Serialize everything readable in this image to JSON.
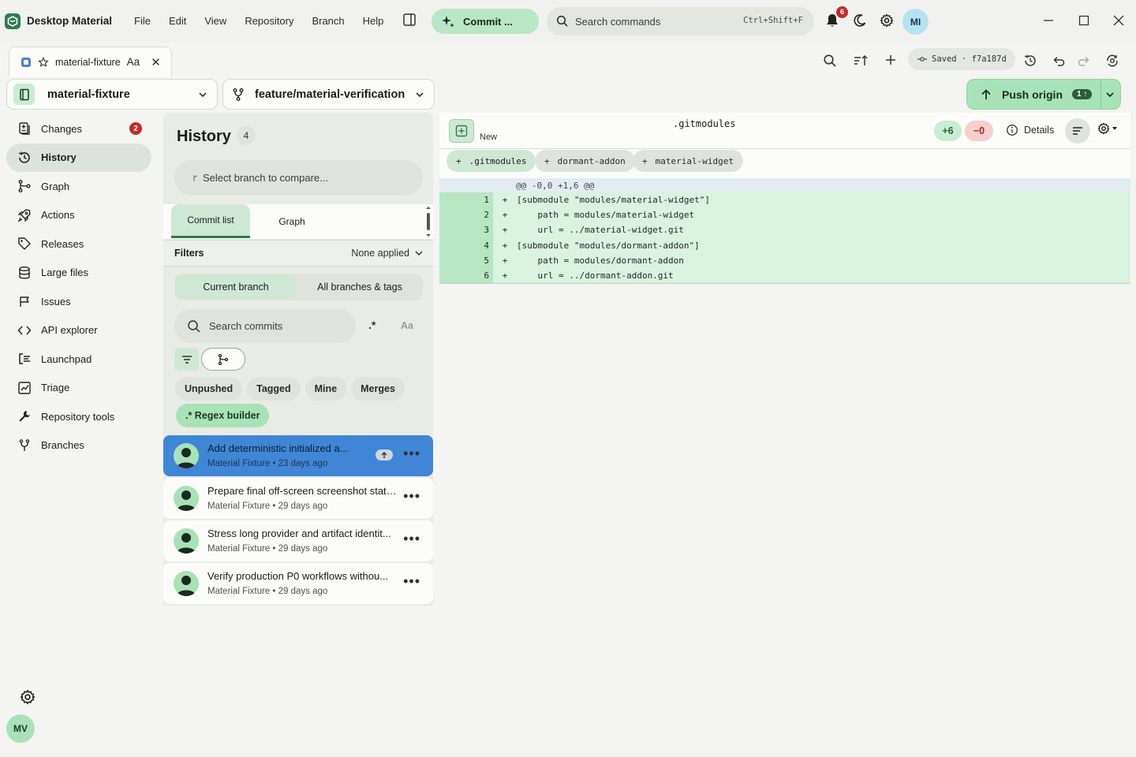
{
  "app": {
    "name": "Desktop Material"
  },
  "menu": [
    "File",
    "Edit",
    "View",
    "Repository",
    "Branch",
    "Help"
  ],
  "commit_button": {
    "label": "Commit ..."
  },
  "command_search": {
    "placeholder": "Search commands",
    "shortcut": "Ctrl+Shift+F"
  },
  "notifications": {
    "count": "6"
  },
  "user": {
    "initials": "MI"
  },
  "tab": {
    "title": "material-fixture",
    "font_toggle": "Aa"
  },
  "save_status": {
    "text": "Saved · f7a187d"
  },
  "repo": {
    "name": "material-fixture"
  },
  "branch": {
    "name": "feature/material-verification"
  },
  "push": {
    "label": "Push origin",
    "count": "1"
  },
  "sidebar": {
    "items": [
      {
        "label": "Changes",
        "icon": "changes-icon",
        "badge": "2"
      },
      {
        "label": "History",
        "icon": "history-icon"
      },
      {
        "label": "Graph",
        "icon": "graph-icon"
      },
      {
        "label": "Actions",
        "icon": "rocket-icon"
      },
      {
        "label": "Releases",
        "icon": "tag-icon"
      },
      {
        "label": "Large files",
        "icon": "database-icon"
      },
      {
        "label": "Issues",
        "icon": "issue-icon"
      },
      {
        "label": "API explorer",
        "icon": "code-icon"
      },
      {
        "label": "Launchpad",
        "icon": "launchpad-icon"
      },
      {
        "label": "Triage",
        "icon": "triage-icon"
      },
      {
        "label": "Repository tools",
        "icon": "wrench-icon"
      },
      {
        "label": "Branches",
        "icon": "branch-icon"
      }
    ],
    "active": "History",
    "user_initials": "MV"
  },
  "history": {
    "title": "History",
    "count": "4",
    "compare_placeholder": "Select branch to compare...",
    "tabs": [
      "Commit list",
      "Graph"
    ],
    "filters_label": "Filters",
    "filters_value": "None applied",
    "scope": [
      "Current branch",
      "All branches & tags"
    ],
    "search_placeholder": "Search commits",
    "regex_toggle": ".*",
    "case_toggle": "Aa",
    "quick_filters": [
      "Unpushed",
      "Tagged",
      "Mine",
      "Merges"
    ],
    "regex_builder": ".* Regex builder",
    "commits": [
      {
        "title": "Add deterministic initialized a...",
        "meta": "Material Fixture • 23 days ago",
        "selected": true,
        "unpushed": true
      },
      {
        "title": "Prepare final off-screen screenshot states",
        "meta": "Material Fixture • 29 days ago"
      },
      {
        "title": "Stress long provider and artifact identit...",
        "meta": "Material Fixture • 29 days ago"
      },
      {
        "title": "Verify production P0 workflows withou...",
        "meta": "Material Fixture • 29 days ago"
      }
    ]
  },
  "diff": {
    "status": "New",
    "filename": ".gitmodules",
    "additions": "+6",
    "deletions": "−0",
    "details_label": "Details",
    "files": [
      ".gitmodules",
      "dormant-addon",
      "material-widget"
    ],
    "hunk": "@@ -0,0 +1,6 @@",
    "lines": [
      {
        "n": "1",
        "sign": "+",
        "code": "[submodule \"modules/material-widget\"]"
      },
      {
        "n": "2",
        "sign": "+",
        "code": "    path = modules/material-widget"
      },
      {
        "n": "3",
        "sign": "+",
        "code": "    url = ../material-widget.git"
      },
      {
        "n": "4",
        "sign": "+",
        "code": "[submodule \"modules/dormant-addon\"]"
      },
      {
        "n": "5",
        "sign": "+",
        "code": "    path = modules/dormant-addon"
      },
      {
        "n": "6",
        "sign": "+",
        "code": "    url = ../dormant-addon.git"
      }
    ]
  },
  "colors": {
    "accent": "#2e7d4f",
    "selected_commit": "#3f86d6",
    "added_line": "#d8f3df",
    "badge": "#c62828"
  }
}
